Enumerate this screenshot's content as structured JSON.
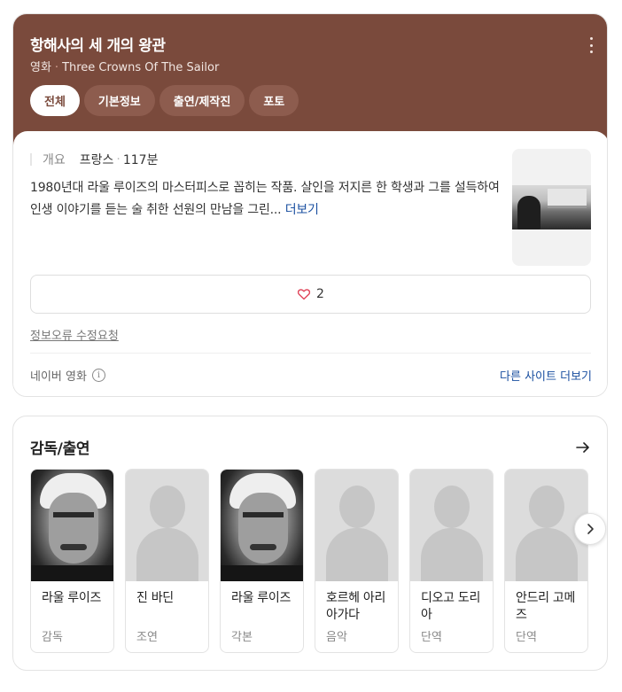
{
  "header": {
    "title": "항해사의 세 개의 왕관",
    "category": "영화",
    "original_title": "Three Crowns Of The Sailor",
    "menu_icon": "more-vertical-icon",
    "brand_color": "#7a4a3c"
  },
  "tabs": [
    {
      "label": "전체",
      "active": true
    },
    {
      "label": "기본정보",
      "active": false
    },
    {
      "label": "출연/제작진",
      "active": false
    },
    {
      "label": "포토",
      "active": false
    }
  ],
  "overview": {
    "label": "개요",
    "country": "프랑스",
    "runtime": "117분",
    "synopsis": "1980년대 라울 루이즈의 마스터피스로 꼽히는 작품. 살인을 저지른 한 학생과 그를 설득하여 인생 이야기를 듣는 술 취한 선원의 만남을 그린...",
    "more_label": "더보기"
  },
  "like": {
    "icon": "heart-icon",
    "count": "2"
  },
  "report_label": "정보오류 수정요청",
  "source_label": "네이버 영화",
  "other_sites_label": "다른 사이트 더보기",
  "cast_section": {
    "title": "감독/출연",
    "people": [
      {
        "name": "라울 루이즈",
        "role": "감독",
        "photo": "portrait"
      },
      {
        "name": "진 바딘",
        "role": "조연",
        "photo": "placeholder"
      },
      {
        "name": "라울 루이즈",
        "role": "각본",
        "photo": "portrait"
      },
      {
        "name": "호르헤 아리아가다",
        "role": "음악",
        "photo": "placeholder"
      },
      {
        "name": "디오고 도리아",
        "role": "단역",
        "photo": "placeholder"
      },
      {
        "name": "안드리 고메즈",
        "role": "단역",
        "photo": "placeholder"
      }
    ]
  }
}
